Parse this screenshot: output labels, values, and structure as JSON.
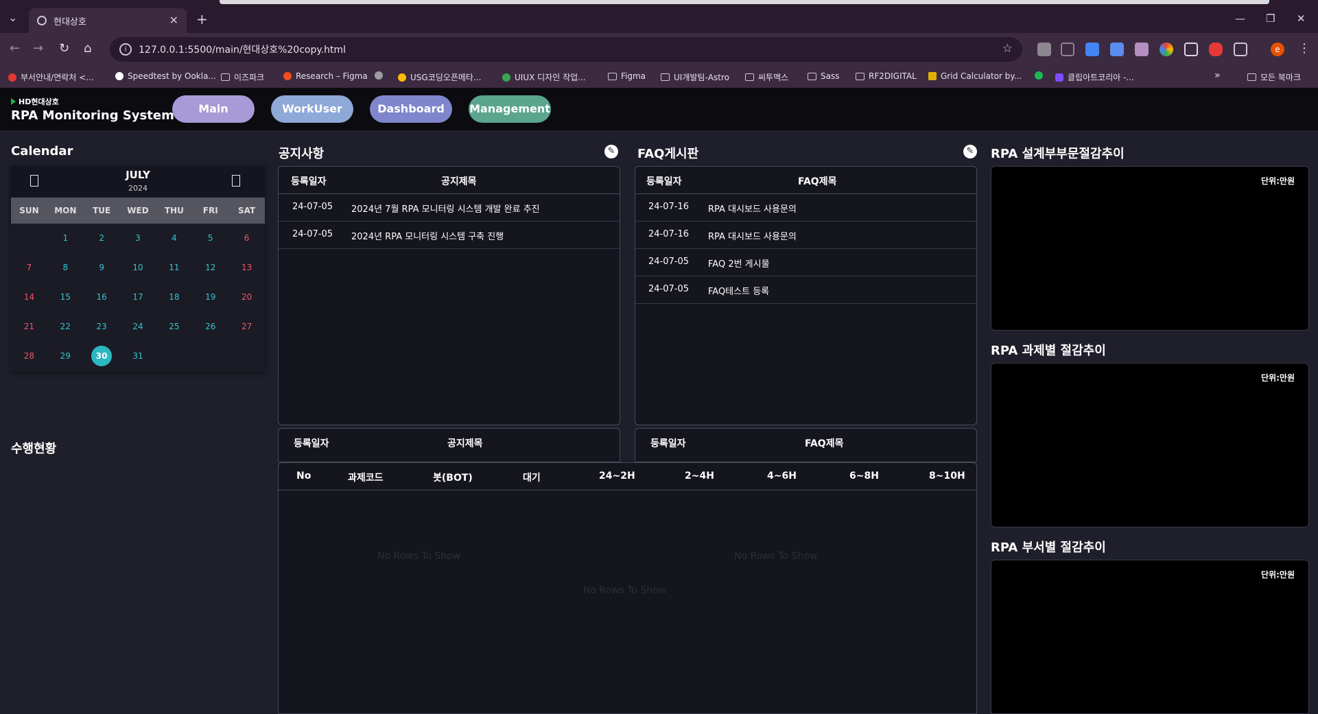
{
  "browser": {
    "tab_title": "현대상호",
    "url": "127.0.0.1:5500/main/현대상호%20copy.html",
    "bookmarks": [
      {
        "label": "부서안내/연락처 <...",
        "color": "#e53935"
      },
      {
        "label": "Speedtest by Ookla...",
        "color": "#ffffff"
      },
      {
        "label": "이즈파크",
        "folder": true
      },
      {
        "label": "Research – Figma",
        "color": "#f24e1e"
      },
      {
        "label": "",
        "color": "#9e9e9e"
      },
      {
        "label": "USG코딩오픈메타...",
        "color": "#fbbc04"
      },
      {
        "label": "UIUX 디자인 작업...",
        "color": "#34a853"
      },
      {
        "label": "Figma",
        "folder": true
      },
      {
        "label": "UI개발팀-Astro",
        "folder": true
      },
      {
        "label": "씨투맥스",
        "folder": true
      },
      {
        "label": "Sass",
        "folder": true
      },
      {
        "label": "RF2DIGITAL",
        "folder": true
      },
      {
        "label": "Grid Calculator by...",
        "color": "#e0b000"
      },
      {
        "label": "",
        "color": "#1db954"
      },
      {
        "label": "클립아트코리아 -...",
        "color": "#7c4dff"
      }
    ],
    "all_bookmarks": "모든 북마크",
    "profile_initial": "e"
  },
  "app": {
    "logo_small": "HD현대상호",
    "logo_title": "RPA Monitoring System",
    "nav": [
      {
        "label": "Main",
        "color": "#a89ad6"
      },
      {
        "label": "WorkUser",
        "color": "#8ea8d8"
      },
      {
        "label": "Dashboard",
        "color": "#7f86cc"
      },
      {
        "label": "Management",
        "color": "#5aa58c"
      }
    ]
  },
  "calendar": {
    "title": "Calendar",
    "month": "JULY",
    "year": "2024",
    "weekdays": [
      "SUN",
      "MON",
      "TUE",
      "WED",
      "THU",
      "FRI",
      "SAT"
    ],
    "weeks": [
      [
        "",
        "1",
        "2",
        "3",
        "4",
        "5",
        "6"
      ],
      [
        "7",
        "8",
        "9",
        "10",
        "11",
        "12",
        "13"
      ],
      [
        "14",
        "15",
        "16",
        "17",
        "18",
        "19",
        "20"
      ],
      [
        "21",
        "22",
        "23",
        "24",
        "25",
        "26",
        "27"
      ],
      [
        "28",
        "29",
        "30",
        "31",
        "",
        "",
        ""
      ]
    ],
    "today": "30"
  },
  "notice": {
    "title": "공지사항",
    "col_date": "등록일자",
    "col_title": "공지제목",
    "rows": [
      {
        "date": "24-07-05",
        "title": "2024년 7월 RPA 모니터링 시스템 개발 완료 추진"
      },
      {
        "date": "24-07-05",
        "title": "2024년 RPA 모니터링 시스템 구축 진행"
      }
    ],
    "empty": "No Rows To Show"
  },
  "faq": {
    "title": "FAQ게시판",
    "col_date": "등록일자",
    "col_title": "FAQ제목",
    "rows": [
      {
        "date": "24-07-16",
        "title": "RPA 대시보드 사용문의"
      },
      {
        "date": "24-07-16",
        "title": "RPA 대시보드 사용문의"
      },
      {
        "date": "24-07-05",
        "title": "FAQ 2번 게시물"
      },
      {
        "date": "24-07-05",
        "title": "FAQ테스트 등록"
      }
    ],
    "empty": "No Rows To Show"
  },
  "performance": {
    "title": "수행현황",
    "columns": [
      "No",
      "과제코드",
      "봇(BOT)",
      "대기",
      "24~2H",
      "2~4H",
      "4~6H",
      "6~8H",
      "8~10H"
    ],
    "empty": "No Rows To Show"
  },
  "charts": [
    {
      "title": "RPA 설계부부문절감추이",
      "unit": "단위:만원"
    },
    {
      "title": "RPA 과제별 절감추이",
      "unit": "단위:만원"
    },
    {
      "title": "RPA 부서별 절감추이",
      "unit": "단위:만원"
    }
  ]
}
